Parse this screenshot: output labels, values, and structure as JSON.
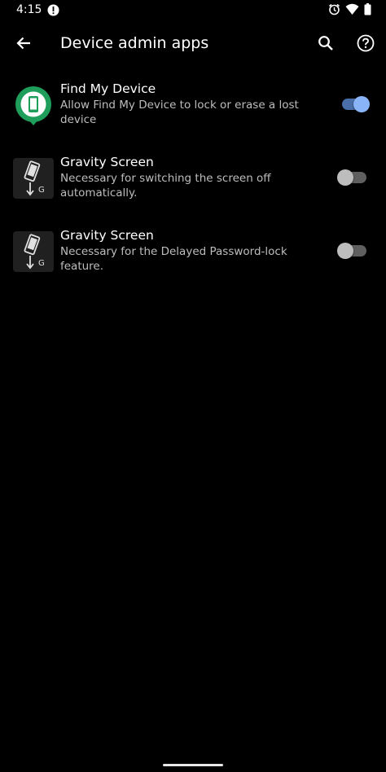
{
  "status_bar": {
    "time": "4:15",
    "icons": [
      "alert-icon",
      "alarm-icon",
      "wifi-icon",
      "battery-icon"
    ]
  },
  "app_bar": {
    "title": "Device admin apps",
    "back_icon": "back-arrow-icon",
    "search_icon": "search-icon",
    "help_icon": "help-icon"
  },
  "apps": [
    {
      "title": "Find My Device",
      "summary": "Allow Find My Device to lock or erase a lost device",
      "icon": "find-my-device-icon",
      "enabled": true
    },
    {
      "title": "Gravity Screen",
      "summary": "Necessary for switching the screen off automatically.",
      "icon": "gravity-screen-icon",
      "enabled": false
    },
    {
      "title": "Gravity Screen",
      "summary": "Necessary for the Delayed Password-lock feature.",
      "icon": "gravity-screen-icon",
      "enabled": false
    }
  ],
  "colors": {
    "background": "#000000",
    "switch_on_thumb": "#8ab4f8",
    "switch_on_track": "#4a6ea8",
    "switch_off_thumb": "#bdbdbd",
    "switch_off_track": "#5f5f5f",
    "find_my_device_green": "#1e9e5a"
  }
}
